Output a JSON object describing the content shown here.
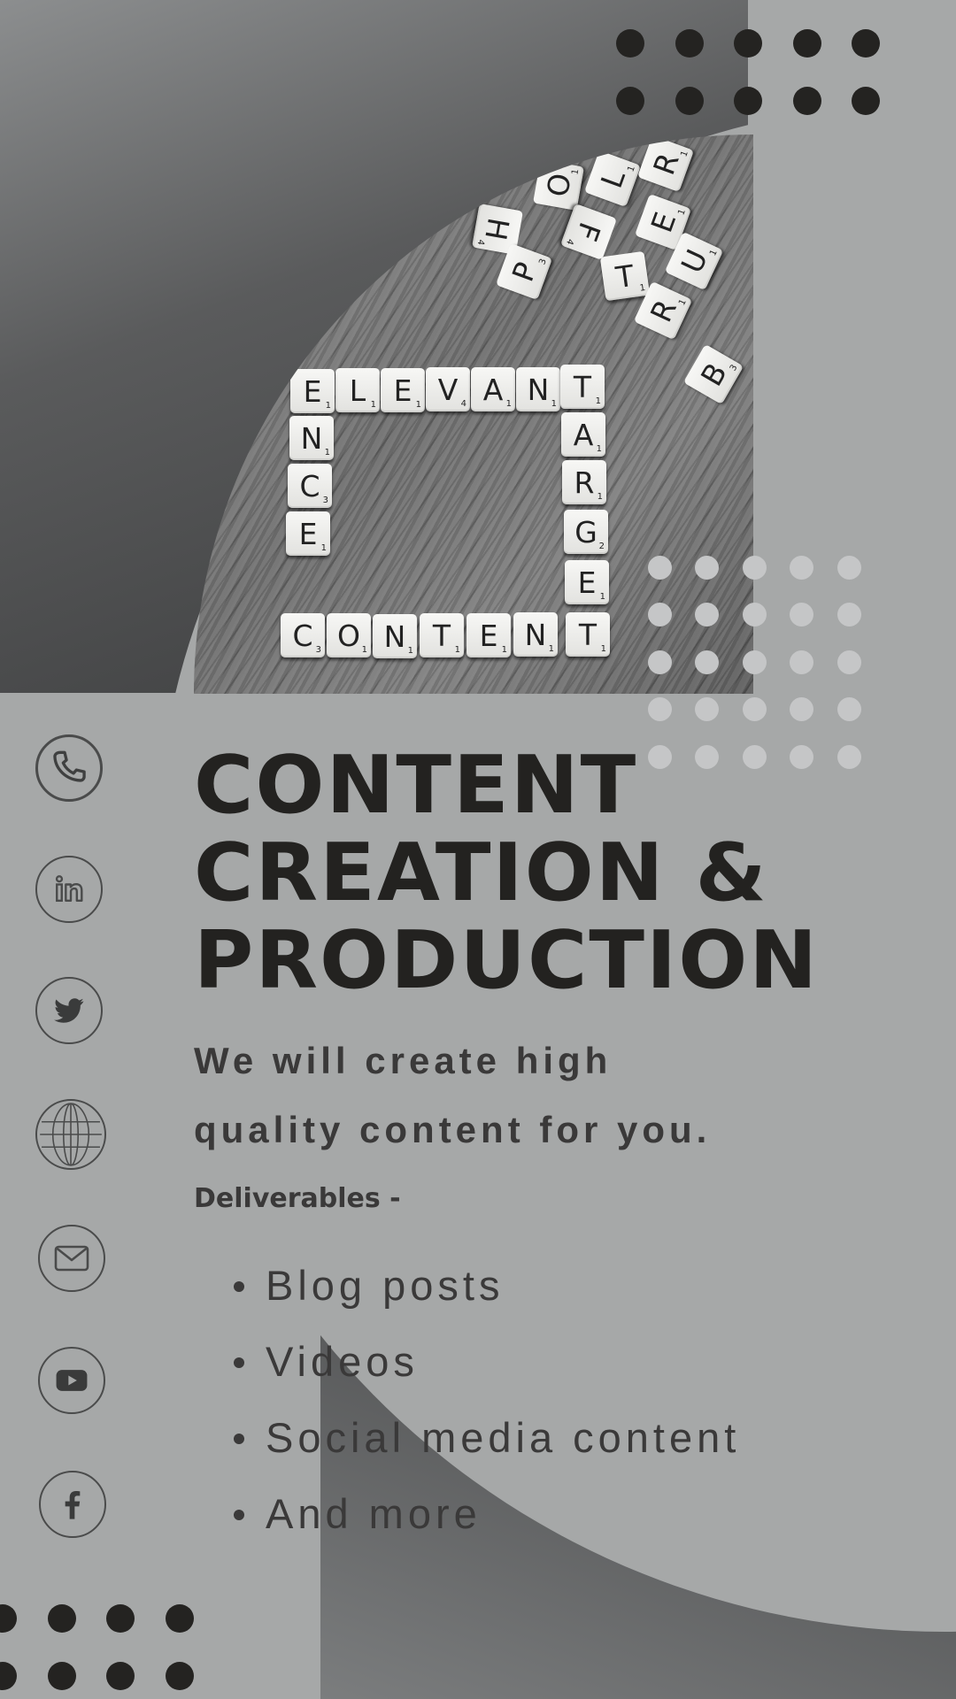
{
  "hero": {
    "title_lines": [
      "CONTENT",
      "CREATION &",
      "PRODUCTION"
    ],
    "tagline": "We will create high quality content for you.",
    "deliverables_label": "Deliverables -",
    "deliverables": [
      "Blog posts",
      "Videos",
      "Social media content",
      "And more"
    ]
  },
  "photo": {
    "tiles": [
      {
        "l": "L",
        "n": "1"
      },
      {
        "l": "E",
        "n": "1"
      },
      {
        "l": "V",
        "n": "4"
      },
      {
        "l": "A",
        "n": "1"
      },
      {
        "l": "N",
        "n": "1"
      },
      {
        "l": "T",
        "n": "1"
      },
      {
        "l": "E",
        "n": "1"
      },
      {
        "l": "N",
        "n": "1"
      },
      {
        "l": "C",
        "n": "3"
      },
      {
        "l": "E",
        "n": "1"
      },
      {
        "l": "A",
        "n": "1"
      },
      {
        "l": "R",
        "n": "1"
      },
      {
        "l": "G",
        "n": "2"
      },
      {
        "l": "E",
        "n": "1"
      },
      {
        "l": "T",
        "n": "1"
      },
      {
        "l": "C",
        "n": "3"
      },
      {
        "l": "O",
        "n": "1"
      },
      {
        "l": "N",
        "n": "1"
      },
      {
        "l": "T",
        "n": "1"
      },
      {
        "l": "E",
        "n": "1"
      },
      {
        "l": "N",
        "n": "1"
      },
      {
        "l": "H",
        "n": "4"
      },
      {
        "l": "P",
        "n": "3"
      },
      {
        "l": "O",
        "n": "1"
      },
      {
        "l": "L",
        "n": "1"
      },
      {
        "l": "R",
        "n": "1"
      },
      {
        "l": "F",
        "n": "4"
      },
      {
        "l": "E",
        "n": "1"
      },
      {
        "l": "T",
        "n": "1"
      },
      {
        "l": "U",
        "n": "1"
      },
      {
        "l": "R",
        "n": "1"
      },
      {
        "l": "B",
        "n": "3"
      }
    ]
  },
  "social_icons": [
    "phone-icon",
    "linkedin-icon",
    "twitter-icon",
    "globe-icon",
    "mail-icon",
    "youtube-icon",
    "facebook-icon"
  ],
  "colors": {
    "background": "#a6a8a8",
    "text_dark": "#232220",
    "text_body": "#3a3939",
    "dot_dark": "#242321",
    "dot_light": "#c5c6c7"
  }
}
